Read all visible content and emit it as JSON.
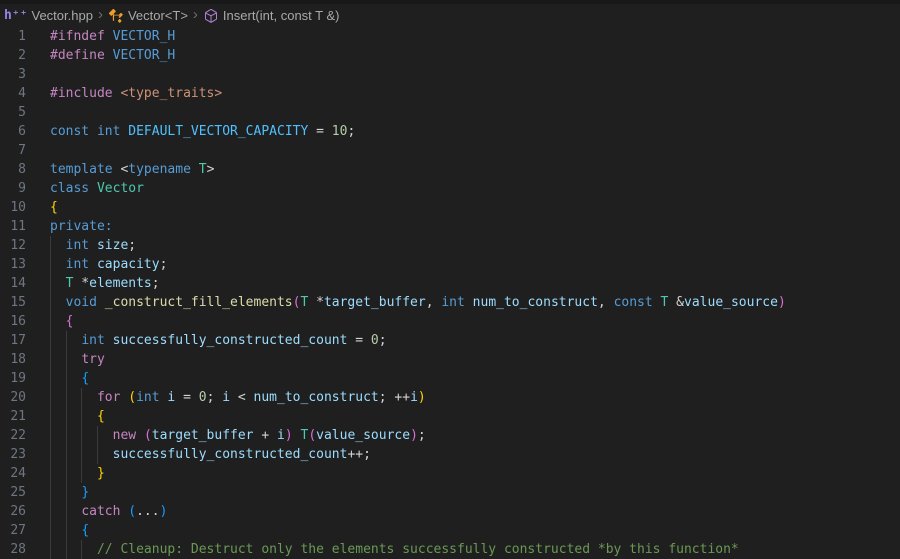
{
  "breadcrumb": {
    "file_icon_glyph": "h⁺⁺",
    "file_label": "Vector.hpp",
    "class_label": "Vector<T>",
    "method_label": "Insert(int, const T &)",
    "separator": "›"
  },
  "colors": {
    "editor_bg": "#1F1F1F",
    "top_strip_bg": "#181818",
    "breadcrumb_fg": "#A9A9A9",
    "separator_fg": "#6E6E6E",
    "line_number_fg": "#6E7681",
    "indent_guide": "#3B3B3B",
    "file_icon": "#9584E8",
    "class_icon": "#EE9D28",
    "method_icon": "#B180D7"
  },
  "token_colors": {
    "pp": "#C586C0",
    "kw": "#569CD6",
    "type": "#4EC9B0",
    "var": "#9CDCFE",
    "fn": "#DCDCAA",
    "num": "#B5CEA8",
    "str": "#CE9178",
    "cmt": "#6A9955",
    "pun": "#D4D4D4",
    "b1": "#FFD700",
    "b2": "#DA70D6",
    "b3": "#179FFF",
    "macro": "#4FC1FF"
  },
  "editor": {
    "lines": [
      {
        "n": 1,
        "guides": 0,
        "tokens": [
          [
            "pp",
            "#ifndef"
          ],
          [
            "kw",
            " VECTOR_H"
          ]
        ]
      },
      {
        "n": 2,
        "guides": 0,
        "tokens": [
          [
            "pp",
            "#define"
          ],
          [
            "kw",
            " VECTOR_H"
          ]
        ]
      },
      {
        "n": 3,
        "guides": 0,
        "tokens": []
      },
      {
        "n": 4,
        "guides": 0,
        "tokens": [
          [
            "pp",
            "#include"
          ],
          [
            "str",
            " <type_traits>"
          ]
        ]
      },
      {
        "n": 5,
        "guides": 0,
        "tokens": []
      },
      {
        "n": 6,
        "guides": 0,
        "tokens": [
          [
            "kw",
            "const"
          ],
          [
            "pun",
            " "
          ],
          [
            "kw",
            "int"
          ],
          [
            "pun",
            " "
          ],
          [
            "macro",
            "DEFAULT_VECTOR_CAPACITY"
          ],
          [
            "pun",
            " = "
          ],
          [
            "num",
            "10"
          ],
          [
            "pun",
            ";"
          ]
        ]
      },
      {
        "n": 7,
        "guides": 0,
        "tokens": []
      },
      {
        "n": 8,
        "guides": 0,
        "tokens": [
          [
            "kw",
            "template"
          ],
          [
            "pun",
            " <"
          ],
          [
            "kw",
            "typename"
          ],
          [
            "pun",
            " "
          ],
          [
            "type",
            "T"
          ],
          [
            "pun",
            ">"
          ]
        ]
      },
      {
        "n": 9,
        "guides": 0,
        "tokens": [
          [
            "kw",
            "class"
          ],
          [
            "pun",
            " "
          ],
          [
            "type",
            "Vector"
          ]
        ]
      },
      {
        "n": 10,
        "guides": 0,
        "tokens": [
          [
            "b1",
            "{"
          ]
        ]
      },
      {
        "n": 11,
        "guides": 0,
        "tokens": [
          [
            "kw",
            "private:"
          ]
        ]
      },
      {
        "n": 12,
        "guides": 1,
        "tokens": [
          [
            "pun",
            "  "
          ],
          [
            "kw",
            "int"
          ],
          [
            "pun",
            " "
          ],
          [
            "var",
            "size"
          ],
          [
            "pun",
            ";"
          ]
        ]
      },
      {
        "n": 13,
        "guides": 1,
        "tokens": [
          [
            "pun",
            "  "
          ],
          [
            "kw",
            "int"
          ],
          [
            "pun",
            " "
          ],
          [
            "var",
            "capacity"
          ],
          [
            "pun",
            ";"
          ]
        ]
      },
      {
        "n": 14,
        "guides": 1,
        "tokens": [
          [
            "pun",
            "  "
          ],
          [
            "type",
            "T"
          ],
          [
            "pun",
            " *"
          ],
          [
            "var",
            "elements"
          ],
          [
            "pun",
            ";"
          ]
        ]
      },
      {
        "n": 15,
        "guides": 1,
        "tokens": [
          [
            "pun",
            "  "
          ],
          [
            "kw",
            "void"
          ],
          [
            "pun",
            " "
          ],
          [
            "fn",
            "_construct_fill_elements"
          ],
          [
            "b2",
            "("
          ],
          [
            "type",
            "T"
          ],
          [
            "pun",
            " *"
          ],
          [
            "var",
            "target_buffer"
          ],
          [
            "pun",
            ", "
          ],
          [
            "kw",
            "int"
          ],
          [
            "pun",
            " "
          ],
          [
            "var",
            "num_to_construct"
          ],
          [
            "pun",
            ", "
          ],
          [
            "kw",
            "const"
          ],
          [
            "pun",
            " "
          ],
          [
            "type",
            "T"
          ],
          [
            "pun",
            " &"
          ],
          [
            "var",
            "value_source"
          ],
          [
            "b2",
            ")"
          ]
        ]
      },
      {
        "n": 16,
        "guides": 1,
        "tokens": [
          [
            "pun",
            "  "
          ],
          [
            "b2",
            "{"
          ]
        ]
      },
      {
        "n": 17,
        "guides": 2,
        "tokens": [
          [
            "pun",
            "    "
          ],
          [
            "kw",
            "int"
          ],
          [
            "pun",
            " "
          ],
          [
            "var",
            "successfully_constructed_count"
          ],
          [
            "pun",
            " = "
          ],
          [
            "num",
            "0"
          ],
          [
            "pun",
            ";"
          ]
        ]
      },
      {
        "n": 18,
        "guides": 2,
        "tokens": [
          [
            "pun",
            "    "
          ],
          [
            "pp",
            "try"
          ]
        ]
      },
      {
        "n": 19,
        "guides": 2,
        "tokens": [
          [
            "pun",
            "    "
          ],
          [
            "b3",
            "{"
          ]
        ]
      },
      {
        "n": 20,
        "guides": 3,
        "tokens": [
          [
            "pun",
            "      "
          ],
          [
            "pp",
            "for"
          ],
          [
            "pun",
            " "
          ],
          [
            "b1",
            "("
          ],
          [
            "kw",
            "int"
          ],
          [
            "pun",
            " "
          ],
          [
            "var",
            "i"
          ],
          [
            "pun",
            " = "
          ],
          [
            "num",
            "0"
          ],
          [
            "pun",
            "; "
          ],
          [
            "var",
            "i"
          ],
          [
            "pun",
            " < "
          ],
          [
            "var",
            "num_to_construct"
          ],
          [
            "pun",
            "; ++"
          ],
          [
            "var",
            "i"
          ],
          [
            "b1",
            ")"
          ]
        ]
      },
      {
        "n": 21,
        "guides": 3,
        "tokens": [
          [
            "pun",
            "      "
          ],
          [
            "b1",
            "{"
          ]
        ]
      },
      {
        "n": 22,
        "guides": 4,
        "tokens": [
          [
            "pun",
            "        "
          ],
          [
            "pp",
            "new"
          ],
          [
            "pun",
            " "
          ],
          [
            "b2",
            "("
          ],
          [
            "var",
            "target_buffer"
          ],
          [
            "pun",
            " + "
          ],
          [
            "var",
            "i"
          ],
          [
            "b2",
            ")"
          ],
          [
            "pun",
            " "
          ],
          [
            "type",
            "T"
          ],
          [
            "b2",
            "("
          ],
          [
            "var",
            "value_source"
          ],
          [
            "b2",
            ")"
          ],
          [
            "pun",
            ";"
          ]
        ]
      },
      {
        "n": 23,
        "guides": 4,
        "tokens": [
          [
            "pun",
            "        "
          ],
          [
            "var",
            "successfully_constructed_count"
          ],
          [
            "pun",
            "++;"
          ]
        ]
      },
      {
        "n": 24,
        "guides": 3,
        "tokens": [
          [
            "pun",
            "      "
          ],
          [
            "b1",
            "}"
          ]
        ]
      },
      {
        "n": 25,
        "guides": 2,
        "tokens": [
          [
            "pun",
            "    "
          ],
          [
            "b3",
            "}"
          ]
        ]
      },
      {
        "n": 26,
        "guides": 2,
        "tokens": [
          [
            "pun",
            "    "
          ],
          [
            "pp",
            "catch"
          ],
          [
            "pun",
            " "
          ],
          [
            "b3",
            "("
          ],
          [
            "pun",
            "..."
          ],
          [
            "b3",
            ")"
          ]
        ]
      },
      {
        "n": 27,
        "guides": 2,
        "tokens": [
          [
            "pun",
            "    "
          ],
          [
            "b3",
            "{"
          ]
        ]
      },
      {
        "n": 28,
        "guides": 3,
        "tokens": [
          [
            "pun",
            "      "
          ],
          [
            "cmt",
            "// Cleanup: Destruct only the elements successfully constructed *by this function*"
          ]
        ]
      }
    ]
  }
}
